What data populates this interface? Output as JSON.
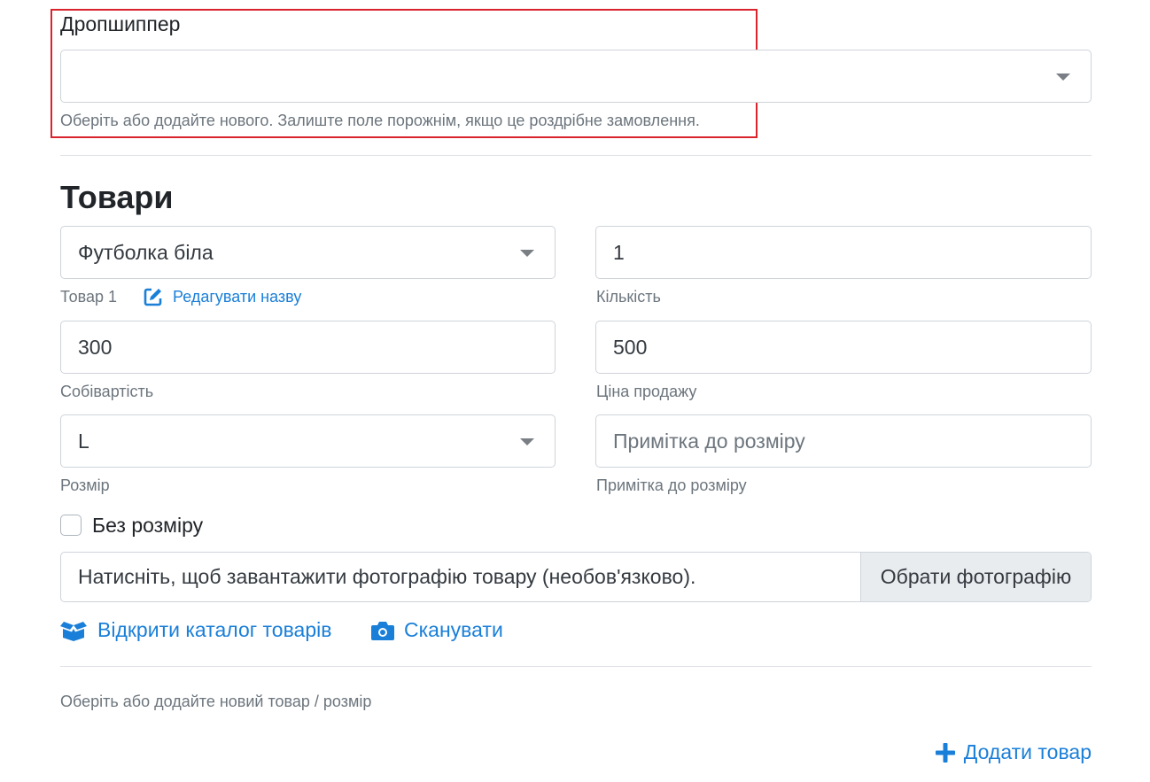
{
  "dropshipper": {
    "label": "Дропшиппер",
    "value": "",
    "help": "Оберіть або додайте нового. Залиште поле порожнім, якщо це роздрібне замовлення."
  },
  "products_section": {
    "title": "Товари",
    "product": {
      "value": "Футболка біла",
      "label": "Товар 1",
      "edit_name_link": "Редагувати назву"
    },
    "quantity": {
      "value": "1",
      "label": "Кількість"
    },
    "cost": {
      "value": "300",
      "label": "Собівартість"
    },
    "sale_price": {
      "value": "500",
      "label": "Ціна продажу"
    },
    "size": {
      "value": "L",
      "label": "Розмір"
    },
    "size_note": {
      "placeholder": "Примітка до розміру",
      "label": "Примітка до розміру"
    },
    "no_size_checkbox": {
      "label": "Без розміру",
      "checked": false
    },
    "photo": {
      "text": "Натисніть, щоб завантажити фотографію товару (необов'язково).",
      "button": "Обрати фотографію"
    },
    "open_catalog_link": "Відкрити каталог товарів",
    "scan_link": "Сканувати",
    "add_help": "Оберіть або додайте новий товар / розмір",
    "add_product_button": "Додати товар"
  },
  "colors": {
    "accent": "#1a7fd8",
    "highlight": "#d9232d"
  }
}
